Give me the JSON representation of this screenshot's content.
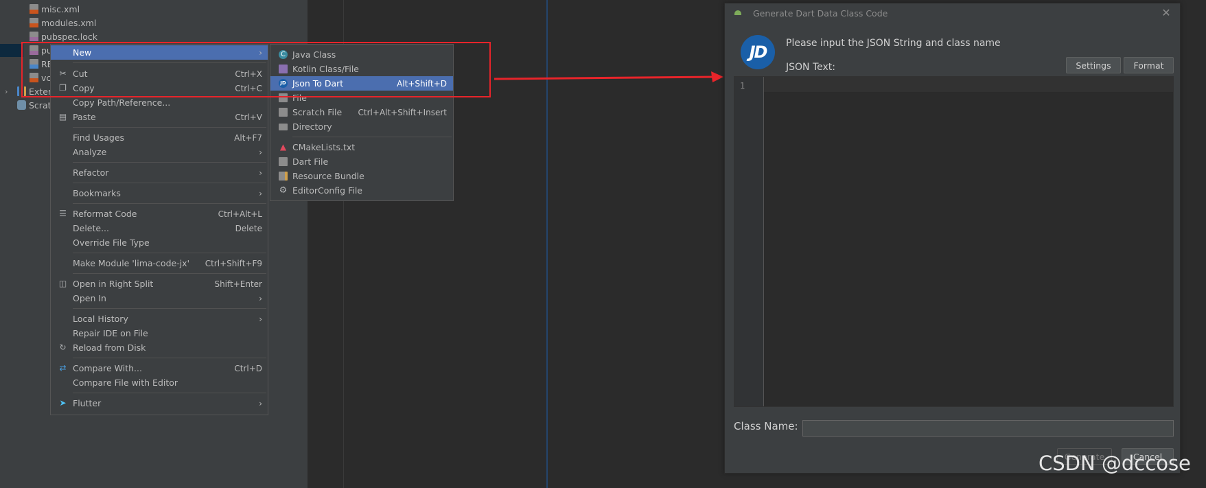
{
  "colors": {
    "menu_bg": "#3c3f41",
    "selection": "#4b6eaf",
    "annotation_red": "#e8242a",
    "editor_bg": "#2b2b2b",
    "jd_blue": "#1a5fa8"
  },
  "tree": {
    "items": [
      {
        "label": "misc.xml",
        "icon": "xml-file-icon"
      },
      {
        "label": "modules.xml",
        "icon": "xml-file-icon"
      },
      {
        "label": "pubspec.lock",
        "icon": "yml-file-icon"
      },
      {
        "label": "pu",
        "icon": "yml-file-icon"
      },
      {
        "label": "RE",
        "icon": "md-file-icon"
      },
      {
        "label": "vc",
        "icon": "xml-file-icon"
      },
      {
        "label": "Exter",
        "icon": "library-icon"
      },
      {
        "label": "Scrat",
        "icon": "scratches-icon"
      }
    ]
  },
  "context_menu": {
    "items": [
      {
        "label": "New",
        "shortcut": "",
        "submenu": true,
        "selected": true,
        "icon": ""
      },
      {
        "label": "Cut",
        "shortcut": "Ctrl+X",
        "icon": "scissors-icon"
      },
      {
        "label": "Copy",
        "shortcut": "Ctrl+C",
        "icon": "copy-icon"
      },
      {
        "label": "Copy Path/Reference...",
        "shortcut": ""
      },
      {
        "label": "Paste",
        "shortcut": "Ctrl+V",
        "icon": "clipboard-icon"
      },
      {
        "label": "Find Usages",
        "shortcut": "Alt+F7"
      },
      {
        "label": "Analyze",
        "shortcut": "",
        "submenu": true
      },
      {
        "label": "Refactor",
        "shortcut": "",
        "submenu": true
      },
      {
        "label": "Bookmarks",
        "shortcut": "",
        "submenu": true
      },
      {
        "label": "Reformat Code",
        "shortcut": "Ctrl+Alt+L",
        "icon": "reformat-icon"
      },
      {
        "label": "Delete...",
        "shortcut": "Delete"
      },
      {
        "label": "Override File Type",
        "shortcut": ""
      },
      {
        "label": "Make Module 'lima-code-jx'",
        "shortcut": "Ctrl+Shift+F9"
      },
      {
        "label": "Open in Right Split",
        "shortcut": "Shift+Enter",
        "icon": "split-icon"
      },
      {
        "label": "Open In",
        "shortcut": "",
        "submenu": true
      },
      {
        "label": "Local History",
        "shortcut": "",
        "submenu": true
      },
      {
        "label": "Repair IDE on File",
        "shortcut": ""
      },
      {
        "label": "Reload from Disk",
        "shortcut": "",
        "icon": "reload-icon"
      },
      {
        "label": "Compare With...",
        "shortcut": "Ctrl+D",
        "icon": "compare-icon"
      },
      {
        "label": "Compare File with Editor",
        "shortcut": ""
      },
      {
        "label": "Flutter",
        "shortcut": "",
        "submenu": true,
        "icon": "flutter-icon"
      }
    ]
  },
  "submenu": {
    "items": [
      {
        "label": "Java Class",
        "shortcut": "",
        "icon": "java-class-icon"
      },
      {
        "label": "Kotlin Class/File",
        "shortcut": "",
        "icon": "kotlin-file-icon"
      },
      {
        "label": "Json To Dart",
        "shortcut": "Alt+Shift+D",
        "selected": true,
        "icon": "jd-plugin-icon"
      },
      {
        "label": "File",
        "shortcut": "",
        "icon": "file-icon"
      },
      {
        "label": "Scratch File",
        "shortcut": "Ctrl+Alt+Shift+Insert",
        "icon": "scratch-file-icon"
      },
      {
        "label": "Directory",
        "shortcut": "",
        "icon": "folder-icon"
      },
      {
        "label": "CMakeLists.txt",
        "shortcut": "",
        "icon": "cmake-icon"
      },
      {
        "label": "Dart File",
        "shortcut": "",
        "icon": "dart-file-icon"
      },
      {
        "label": "Resource Bundle",
        "shortcut": "",
        "icon": "resource-bundle-icon"
      },
      {
        "label": "EditorConfig File",
        "shortcut": "",
        "icon": "gear-icon"
      }
    ]
  },
  "dialog": {
    "title": "Generate Dart Data Class Code",
    "logo_text": "JD",
    "prompt": "Please input the JSON String and class name",
    "json_label": "JSON Text:",
    "settings_label": "Settings",
    "format_label": "Format",
    "line_number": "1",
    "json_value": "",
    "class_name_label": "Class Name:",
    "class_name_value": "",
    "generate_label": "Generate",
    "cancel_label": "Cancel"
  },
  "watermark": "CSDN @dccose"
}
